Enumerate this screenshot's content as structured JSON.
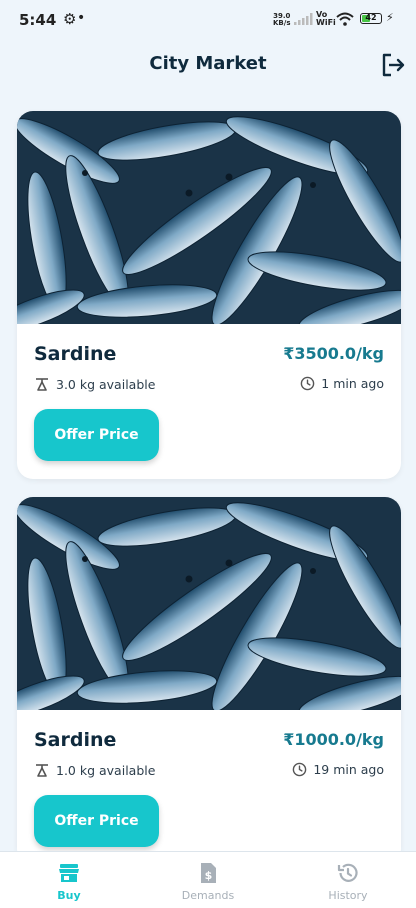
{
  "status_bar": {
    "time": "5:44",
    "dot": "•",
    "net_speed": "39.0",
    "net_unit": "KB/s",
    "vo": "Vo",
    "wifi": "WiFi",
    "battery": "42"
  },
  "header": {
    "title": "City Market"
  },
  "listings": [
    {
      "name": "Sardine",
      "price": "₹3500.0/kg",
      "quantity": "3.0 kg available",
      "posted": "1 min ago",
      "action": "Offer Price"
    },
    {
      "name": "Sardine",
      "price": "₹1000.0/kg",
      "quantity": "1.0 kg available",
      "posted": "19 min ago",
      "action": "Offer Price"
    }
  ],
  "bottom_nav": {
    "items": [
      {
        "label": "Buy",
        "icon": "store-icon",
        "active": true
      },
      {
        "label": "Demands",
        "icon": "dollar-document-icon",
        "active": false
      },
      {
        "label": "History",
        "icon": "history-icon",
        "active": false
      }
    ],
    "active_color": "#17c6cc",
    "inactive_color": "#a8b0b8"
  },
  "colors": {
    "accent": "#17c6cc",
    "price": "#177a8f",
    "background": "#eef5fb"
  }
}
